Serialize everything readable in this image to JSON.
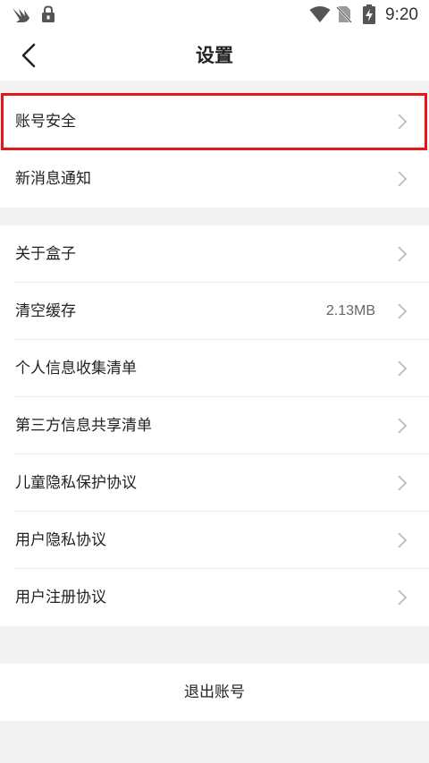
{
  "status_bar": {
    "time": "9:20",
    "left_icons": [
      "bird-app-icon",
      "lock-notification-icon"
    ],
    "right_icons": [
      "wifi-icon",
      "no-sim-icon",
      "battery-charging-icon"
    ]
  },
  "header": {
    "title": "设置",
    "back_icon": "chevron-left-icon"
  },
  "group1": {
    "items": [
      {
        "label": "账号安全",
        "value": ""
      },
      {
        "label": "新消息通知",
        "value": ""
      }
    ]
  },
  "group2": {
    "items": [
      {
        "label": "关于盒子",
        "value": ""
      },
      {
        "label": "清空缓存",
        "value": "2.13MB"
      },
      {
        "label": "个人信息收集清单",
        "value": ""
      },
      {
        "label": "第三方信息共享清单",
        "value": ""
      },
      {
        "label": "儿童隐私保护协议",
        "value": ""
      },
      {
        "label": "用户隐私协议",
        "value": ""
      },
      {
        "label": "用户注册协议",
        "value": ""
      }
    ]
  },
  "logout": {
    "label": "退出账号"
  },
  "colors": {
    "highlight": "#e8141b",
    "background": "#f2f2f2",
    "chevron": "#bbbbbb"
  }
}
